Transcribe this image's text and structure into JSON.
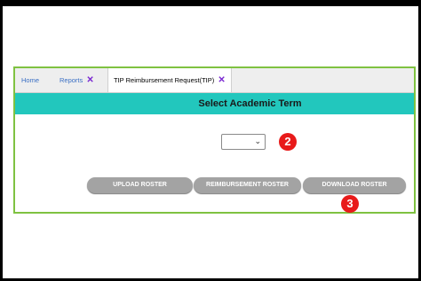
{
  "tabs": {
    "home": "Home",
    "reports": "Reports",
    "active": "TIP Reimbursement Request(TIP)",
    "close_glyph": "✕"
  },
  "header": {
    "title": "Select Academic Term"
  },
  "term_select": {
    "value": "",
    "chevron": "⌄"
  },
  "buttons": {
    "upload": "UPLOAD ROSTER",
    "reimbursement": "REIMBURSEMENT ROSTER",
    "download": "DOWNLOAD ROSTER"
  },
  "annotations": {
    "step2": "2",
    "step3": "3"
  },
  "colors": {
    "panel_border": "#7fc241",
    "header_band": "#22c7bd",
    "badge": "#e81a1a",
    "button": "#a3a3a3",
    "tab_link": "#3a6fc4",
    "close_x": "#7b2ad1"
  }
}
